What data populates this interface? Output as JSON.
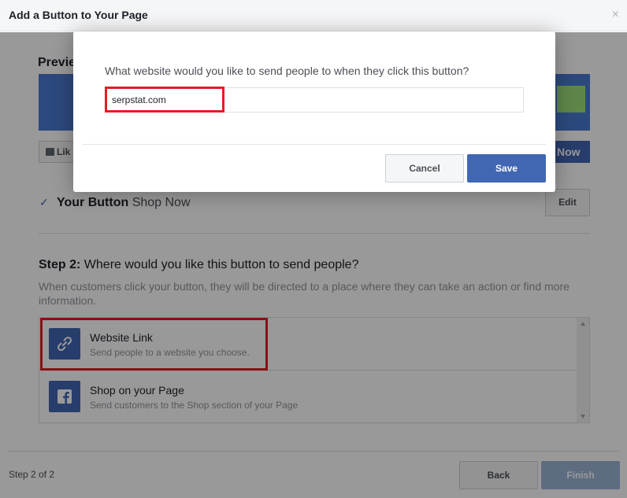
{
  "header": {
    "title": "Add a Button to Your Page",
    "close_glyph": "×"
  },
  "preview": {
    "heading": "Previe",
    "like_label": "Lik",
    "shop_label": "Now",
    "cover_color": "#4a7bd0",
    "accent_color": "#9fe07a"
  },
  "your_button": {
    "check_glyph": "✓",
    "label": "Your Button",
    "value": "Shop Now",
    "edit_label": "Edit"
  },
  "step2": {
    "step": "Step 2:",
    "question": "Where would you like this button to send people?",
    "description": "When customers click your button, they will be directed to a place where they can take an action or find more information.",
    "options": [
      {
        "icon": "link-icon",
        "title": "Website Link",
        "subtitle": "Send people to a website you choose."
      },
      {
        "icon": "facebook-icon",
        "title": "Shop on your Page",
        "subtitle": "Send customers to the Shop section of your Page"
      }
    ]
  },
  "footer": {
    "step_label": "Step 2 of 2",
    "back_label": "Back",
    "finish_label": "Finish"
  },
  "modal": {
    "question": "What website would you like to send people to when they click this button?",
    "url_value": "serpstat.com",
    "cancel_label": "Cancel",
    "save_label": "Save"
  },
  "colors": {
    "primary": "#4267b2",
    "highlight": "#e51c23",
    "disabled": "#9cb4d8"
  }
}
